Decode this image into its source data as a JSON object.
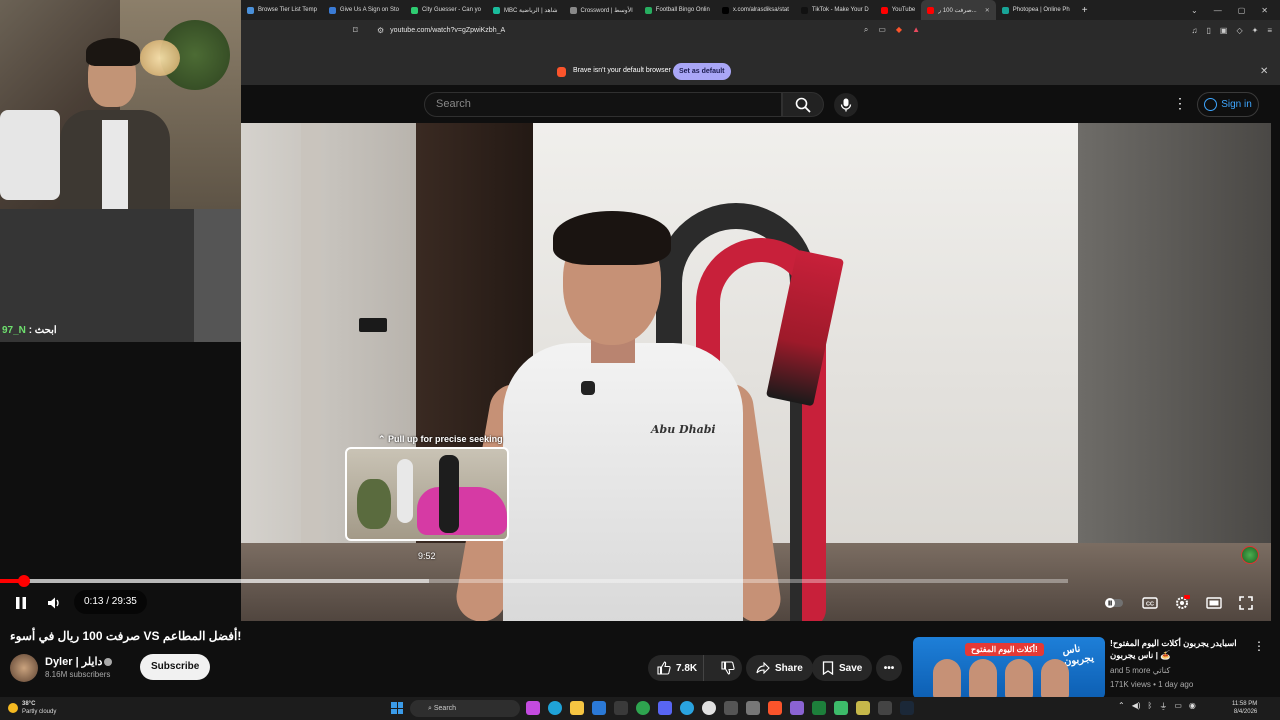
{
  "browser": {
    "tabs": [
      {
        "label": "Browse Tier List Temp",
        "fav": "#4a90d9"
      },
      {
        "label": "Give Us A Sign on Sto",
        "fav": "#3a7bd5"
      },
      {
        "label": "City Guesser - Can yo",
        "fav": "#2ecc71"
      },
      {
        "label": "MBC شاهد | الرياضية",
        "fav": "#1abc9c"
      },
      {
        "label": "Crossword | الأوسط",
        "fav": "#888888"
      },
      {
        "label": "Football Bingo Onlin",
        "fav": "#27ae60"
      },
      {
        "label": "x.com/alrasdiksa/stat",
        "fav": "#000000"
      },
      {
        "label": "TikTok - Make Your D",
        "fav": "#111111"
      },
      {
        "label": "YouTube",
        "fav": "#ff0000"
      },
      {
        "label": "صرفت 100 ر...",
        "fav": "#ff0000",
        "active": true
      },
      {
        "label": "Photopea | Online Ph",
        "fav": "#18a497"
      }
    ],
    "url": "youtube.com/watch?v=gZpwiKzbh_A",
    "infobar_message": "Brave isn't your default browser",
    "infobar_button": "Set as default"
  },
  "stream_overlay": {
    "chat_user": "97_N",
    "chat_message": ": ابحث"
  },
  "youtube": {
    "search_placeholder": "Search",
    "sign_in": "Sign in",
    "seek_hint": "Pull up for precise seeking",
    "seek_preview_time": "9:52",
    "time_display": "0:13 / 29:35",
    "progress": {
      "played_fraction": 0.0073,
      "hover_fraction": 0.3333
    },
    "video_title": "!أفضل المطاعم VS صرفت 100 ريال في أسوء",
    "video_logo_text": "Abu Dhabi",
    "channel_name": "Dyler | دايلر",
    "subscribers": "8.16M subscribers",
    "subscribe_label": "Subscribe",
    "likes": "7.8K",
    "share_label": "Share",
    "save_label": "Save",
    "recommendation": {
      "title": "اسبايدر يجربون أكلات اليوم المفتوح! 🍝 | ناس يجربون",
      "channel": "and 5 more",
      "channel_suffix": "كناتي",
      "meta": "171K views • 1 day ago",
      "thumb_badge": "أكلات اليوم المفتوح!",
      "thumb_brand": "ناس يجربون"
    }
  },
  "taskbar": {
    "temperature": "38°C",
    "weather": "Partly cloudy",
    "search_label": "Search",
    "time": "11:58 PM",
    "date": "8/4/2026"
  },
  "colors": {
    "accent": "#ff0000",
    "link": "#3ea6ff",
    "brave": "#fb542b"
  }
}
